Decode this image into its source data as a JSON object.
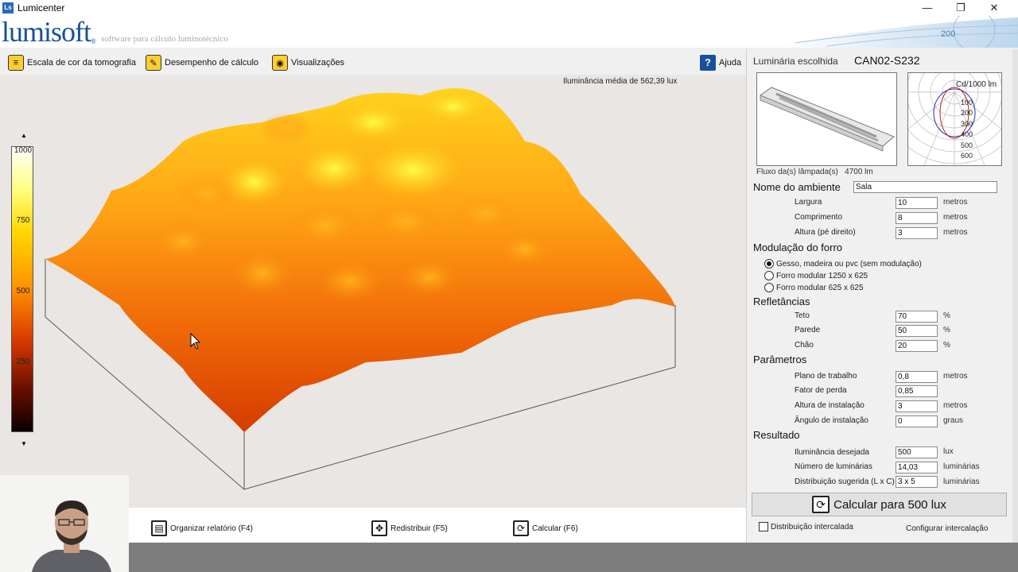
{
  "window": {
    "icon_text": "Ls",
    "title": "Lumicenter",
    "minimize": "—",
    "restore": "❐",
    "close": "✕"
  },
  "brand": {
    "logo": "lumisoft",
    "logo_mark": "®",
    "tagline": "software para cálculo luminotécnico",
    "badge": "200"
  },
  "toolbar": {
    "color_scale": "Escala de cor da tomografia",
    "performance": "Desempenho de cálculo",
    "views": "Visualizações",
    "help": "Ajuda"
  },
  "view": {
    "average_label": "Iluminância média de 562,39 lux",
    "scale_ticks": [
      "1000",
      "750",
      "500",
      "250"
    ]
  },
  "bottom_actions": {
    "report": "Organizar relatório (F4)",
    "redistribute": "Redistribuir (F5)",
    "calculate": "Calcular (F6)"
  },
  "panel": {
    "luminaire_label": "Luminária escolhida",
    "luminaire_code": "CAN02-S232",
    "polar_title": "Cd/1000 lm",
    "polar_rings": [
      "100",
      "200",
      "300",
      "400",
      "500",
      "600"
    ],
    "flux_label": "Fluxo da(s) lâmpada(s)",
    "flux_value": "4700 lm",
    "room_name_label": "Nome do ambiente",
    "room_name_value": "Sala",
    "dimensions": [
      {
        "label": "Largura",
        "value": "10",
        "unit": "metros"
      },
      {
        "label": "Comprimento",
        "value": "8",
        "unit": "metros"
      },
      {
        "label": "Altura (pé direito)",
        "value": "3",
        "unit": "metros"
      }
    ],
    "ceiling_title": "Modulação do forro",
    "ceiling_options": [
      "Gesso, madeira ou pvc (sem modulação)",
      "Forro modular 1250 x 625",
      "Forro modular 625  x 625"
    ],
    "ceiling_selected": 0,
    "reflectance_title": "Refletâncias",
    "reflectances": [
      {
        "label": "Teto",
        "value": "70",
        "unit": "%"
      },
      {
        "label": "Parede",
        "value": "50",
        "unit": "%"
      },
      {
        "label": "Chão",
        "value": "20",
        "unit": "%"
      }
    ],
    "params_title": "Parâmetros",
    "params": [
      {
        "label": "Plano de trabalho",
        "value": "0,8",
        "unit": "metros"
      },
      {
        "label": "Fator de perda",
        "value": "0,85",
        "unit": ""
      },
      {
        "label": "Altura de instalação",
        "value": "3",
        "unit": "metros"
      },
      {
        "label": "Ângulo de instalação",
        "value": "0",
        "unit": "graus"
      }
    ],
    "result_title": "Resultado",
    "results": [
      {
        "label": "Iluminância desejada",
        "value": "500",
        "unit": "lux"
      },
      {
        "label": "Número de luminárias",
        "value": "14,03",
        "unit": "luminárias"
      },
      {
        "label": "Distribuição sugerida (L x C)",
        "value": "3 x 5",
        "unit": "luminárias"
      }
    ],
    "calc_button": "Calcular para 500 lux",
    "interleaved_label": "Distribuição intercalada",
    "interleaved_checked": false,
    "config_link": "Configurar intercalação"
  }
}
